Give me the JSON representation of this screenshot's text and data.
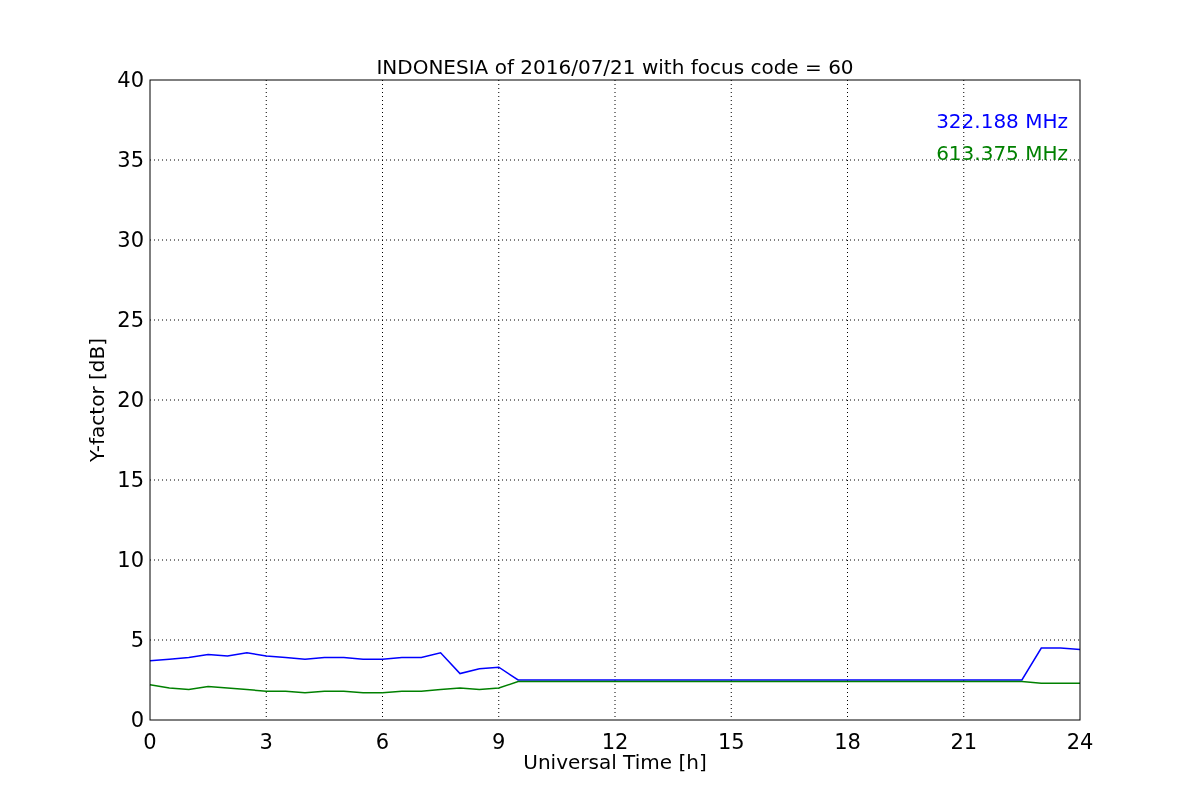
{
  "chart": {
    "chart_data": {
      "type": "line",
      "title": "INDONESIA of 2016/07/21 with focus code = 60",
      "xlabel": "Universal Time [h]",
      "ylabel": "Y-factor [dB]",
      "x": [
        0,
        0.5,
        1,
        1.5,
        2,
        2.5,
        3,
        3.5,
        4,
        4.5,
        5,
        5.5,
        6,
        6.5,
        7,
        7.5,
        8,
        8.5,
        9,
        9.5,
        10,
        10.5,
        11,
        11.5,
        12,
        12.5,
        13,
        13.5,
        14,
        14.5,
        15,
        15.5,
        16,
        16.5,
        17,
        17.5,
        18,
        18.5,
        19,
        19.5,
        20,
        20.5,
        21,
        21.5,
        22,
        22.5,
        23,
        23.5,
        24
      ],
      "series": [
        {
          "name": "322.188 MHz",
          "color": "#0000ff",
          "values": [
            3.7,
            3.8,
            3.9,
            4.1,
            4.0,
            4.2,
            4.0,
            3.9,
            3.8,
            3.9,
            3.9,
            3.8,
            3.8,
            3.9,
            3.9,
            4.2,
            2.9,
            3.2,
            3.3,
            2.5,
            2.5,
            2.5,
            2.5,
            2.5,
            2.5,
            2.5,
            2.5,
            2.5,
            2.5,
            2.5,
            2.5,
            2.5,
            2.5,
            2.5,
            2.5,
            2.5,
            2.5,
            2.5,
            2.5,
            2.5,
            2.5,
            2.5,
            2.5,
            2.5,
            2.5,
            2.5,
            4.5,
            4.5,
            4.4
          ]
        },
        {
          "name": "613.375 MHz",
          "color": "#008000",
          "values": [
            2.2,
            2.0,
            1.9,
            2.1,
            2.0,
            1.9,
            1.8,
            1.8,
            1.7,
            1.8,
            1.8,
            1.7,
            1.7,
            1.8,
            1.8,
            1.9,
            2.0,
            1.9,
            2.0,
            2.4,
            2.4,
            2.4,
            2.4,
            2.4,
            2.4,
            2.4,
            2.4,
            2.4,
            2.4,
            2.4,
            2.4,
            2.4,
            2.4,
            2.4,
            2.4,
            2.4,
            2.4,
            2.4,
            2.4,
            2.4,
            2.4,
            2.4,
            2.4,
            2.4,
            2.4,
            2.4,
            2.3,
            2.3,
            2.3
          ]
        }
      ],
      "xlim": [
        0,
        24
      ],
      "ylim": [
        0,
        40
      ],
      "xticks": [
        0,
        3,
        6,
        9,
        12,
        15,
        18,
        21,
        24
      ],
      "yticks": [
        0,
        5,
        10,
        15,
        20,
        25,
        30,
        35,
        40
      ],
      "grid": true
    }
  }
}
